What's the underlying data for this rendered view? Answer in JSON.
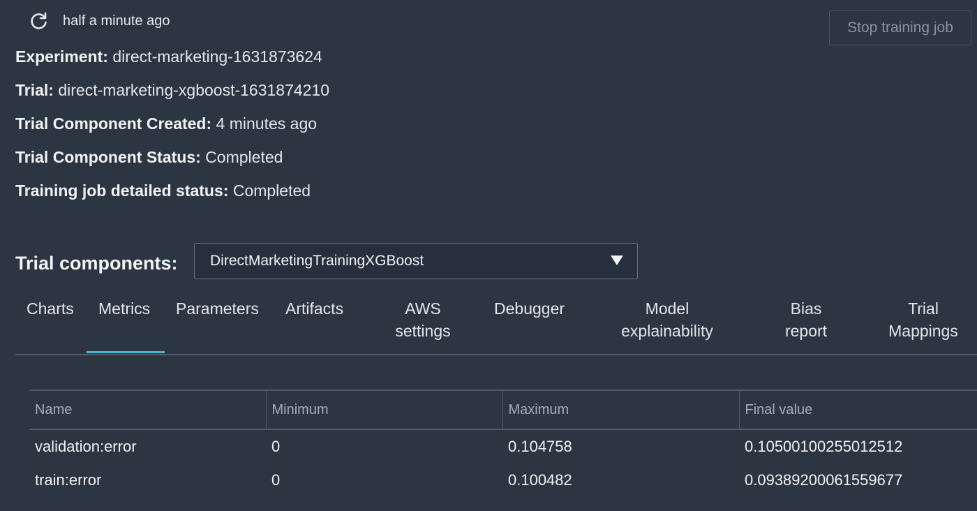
{
  "refresh": {
    "icon": "refresh-icon",
    "timestamp": "half a minute ago"
  },
  "actions": {
    "stop_training_job": "Stop training job"
  },
  "info": {
    "experiment_label": "Experiment:",
    "experiment_value": "direct-marketing-1631873624",
    "trial_label": "Trial:",
    "trial_value": "direct-marketing-xgboost-1631874210",
    "created_label": "Trial Component Created:",
    "created_value": "4 minutes ago",
    "status_label": "Trial Component Status:",
    "status_value": "Completed",
    "job_status_label": "Training job detailed status:",
    "job_status_value": "Completed"
  },
  "trial_components": {
    "label": "Trial components:",
    "selected": "DirectMarketingTrainingXGBoost"
  },
  "tabs": [
    {
      "line1": "Charts",
      "line2": ""
    },
    {
      "line1": "Metrics",
      "line2": "",
      "active": true
    },
    {
      "line1": "Parameters",
      "line2": ""
    },
    {
      "line1": "Artifacts",
      "line2": ""
    },
    {
      "line1": "AWS",
      "line2": "settings"
    },
    {
      "line1": "Debugger",
      "line2": ""
    },
    {
      "line1": "Model",
      "line2": "explainability"
    },
    {
      "line1": "Bias",
      "line2": "report"
    },
    {
      "line1": "Trial",
      "line2": "Mappings"
    }
  ],
  "metrics_table": {
    "columns": [
      "Name",
      "Minimum",
      "Maximum",
      "Final value"
    ],
    "rows": [
      [
        "validation:error",
        "0",
        "0.104758",
        "0.10500100255012512"
      ],
      [
        "train:error",
        "0",
        "0.100482",
        "0.09389200061559677"
      ]
    ]
  },
  "colors": {
    "background": "#2c3542",
    "accent": "#44b9d6",
    "text": "#e4e7ea"
  }
}
